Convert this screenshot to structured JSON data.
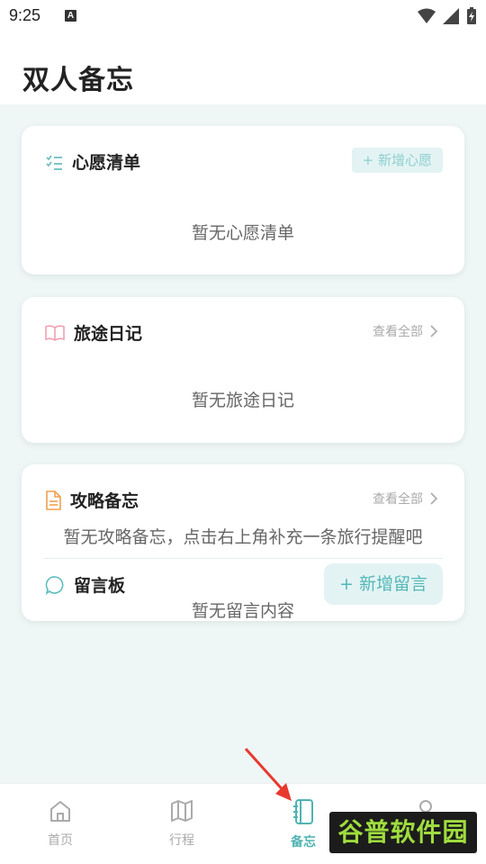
{
  "status_bar": {
    "time": "9:25",
    "notification_glyph": "A"
  },
  "header": {
    "title": "双人备忘"
  },
  "wishlist": {
    "title": "心愿清单",
    "add_button": "+ 新增心愿",
    "empty_text": "暂无心愿清单",
    "icon": "checklist-icon"
  },
  "travel_diary": {
    "title": "旅途日记",
    "view_all": "查看全部",
    "empty_text": "暂无旅途日记",
    "icon": "book-icon"
  },
  "guide_notes": {
    "title": "攻略备忘",
    "view_all": "查看全部",
    "empty_text": "暂无攻略备忘，点击右上角补充一条旅行提醒吧",
    "icon": "document-icon"
  },
  "message_board": {
    "title": "留言板",
    "add_button": "+ 新增留言",
    "empty_text": "暂无留言内容",
    "icon": "chat-bubble-icon"
  },
  "tabbar": {
    "tabs": [
      {
        "label": "首页",
        "icon": "home-icon",
        "active": false
      },
      {
        "label": "行程",
        "icon": "map-icon",
        "active": false
      },
      {
        "label": "备忘",
        "icon": "notebook-icon",
        "active": true
      },
      {
        "label": "",
        "icon": "user-icon",
        "active": false
      }
    ]
  },
  "watermark": {
    "text": "谷普软件园"
  },
  "colors": {
    "accent": "#4fb3b3",
    "background": "#eef6f6",
    "accent_light": "#e3f3f3"
  }
}
